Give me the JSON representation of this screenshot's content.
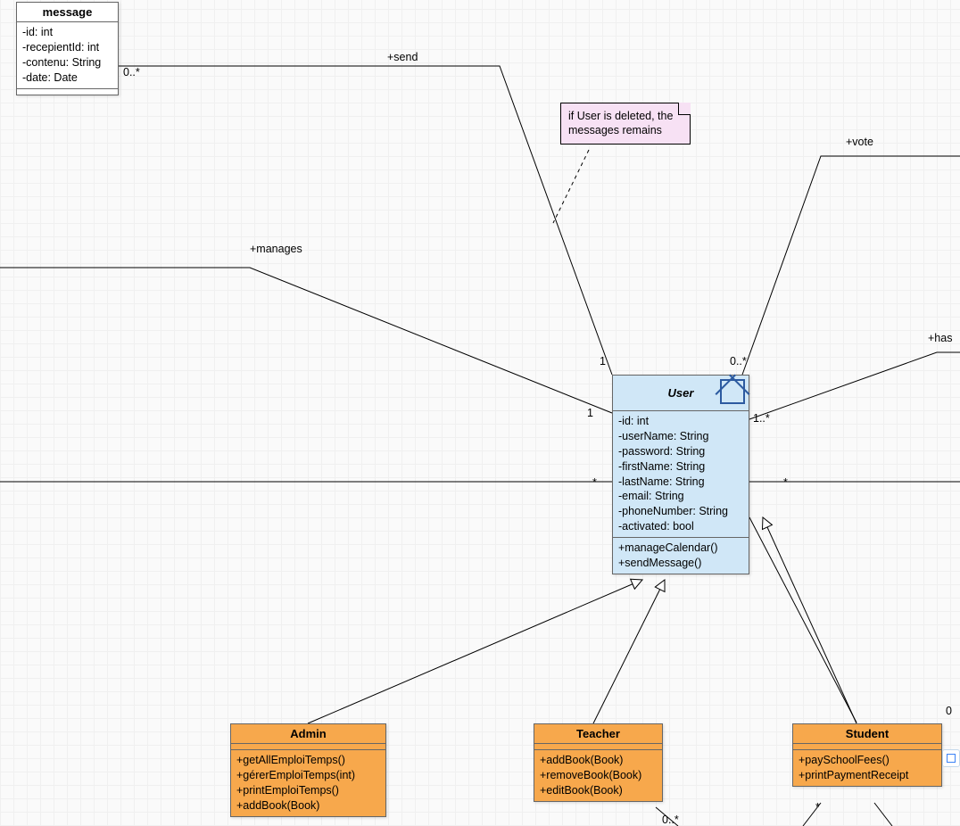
{
  "classes": {
    "message": {
      "name": "message",
      "attrs": [
        "-id: int",
        "-recepientId: int",
        "-contenu: String",
        "-date: Date"
      ]
    },
    "user": {
      "name": "User",
      "attrs": [
        "-id: int",
        "-userName: String",
        "-password: String",
        "-firstName: String",
        "-lastName: String",
        "-email: String",
        "-phoneNumber: String",
        "-activated: bool"
      ],
      "ops": [
        "+manageCalendar()",
        "+sendMessage()"
      ]
    },
    "admin": {
      "name": "Admin",
      "ops": [
        "+getAllEmploiTemps()",
        "+gérerEmploiTemps(int)",
        "+printEmploiTemps()",
        "+addBook(Book)"
      ]
    },
    "teacher": {
      "name": "Teacher",
      "ops": [
        "+addBook(Book)",
        "+removeBook(Book)",
        "+editBook(Book)"
      ]
    },
    "student": {
      "name": "Student",
      "ops": [
        "+paySchoolFees()",
        "+printPaymentReceipt"
      ]
    }
  },
  "note": {
    "text": "if User is deleted, the messages remains"
  },
  "labels": {
    "send": "+send",
    "manages": "+manages",
    "vote": "+vote",
    "has": "+has",
    "m_msg": "0..*",
    "m_userTopLeft": "1",
    "m_userTopRight": "0..*",
    "m_userLeft": "1",
    "m_userRight": "1..*",
    "m_starL": "*",
    "m_starR": "*",
    "m_starBR": "*",
    "m_zeroTR": "0",
    "m_zeroStarBM": "0..*"
  }
}
